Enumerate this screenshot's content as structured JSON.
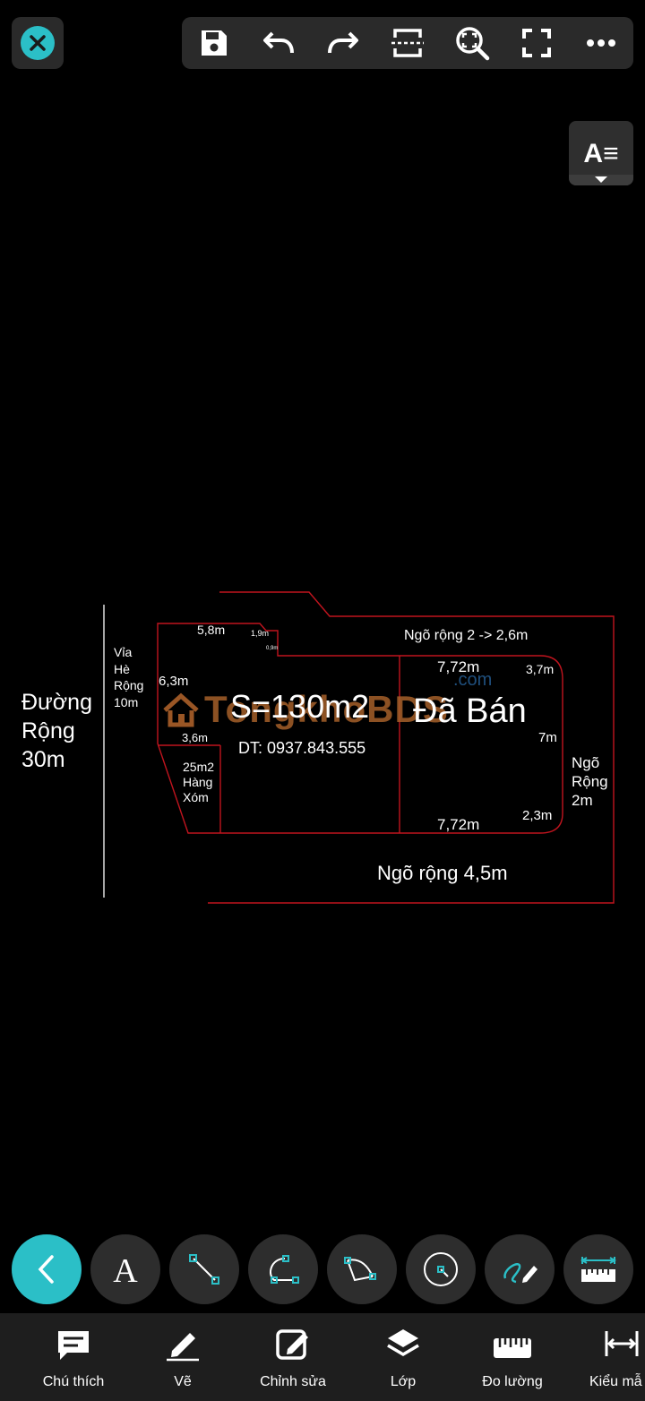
{
  "toolbar": {
    "icons": [
      "close-icon",
      "save-icon",
      "undo-icon",
      "redo-icon",
      "scan-icon",
      "zoom-extents-icon",
      "fullscreen-icon",
      "more-icon"
    ]
  },
  "text_style_button": {
    "label": "A≡"
  },
  "drawing": {
    "road_main": [
      "Đường",
      "Rộng",
      "30m"
    ],
    "sidewalk": [
      "Vỉa",
      "Hè",
      "Rộng",
      "10m"
    ],
    "dim_5_8": "5,8m",
    "dim_1_9": "1,9m",
    "dim_0_9": "0,9m",
    "dim_6_3": "6,3m",
    "dim_3_6": "3,6m",
    "neighbor": [
      "25m2",
      "Hàng",
      "Xóm"
    ],
    "area": "S=130m2",
    "phone": "DT: 0937.843.555",
    "alley_top": "Ngõ rộng 2 -> 2,6m",
    "dim_7_72_top": "7,72m",
    "dim_3_7": "3,7m",
    "sold": "Đã Bán",
    "dim_7m": "7m",
    "dim_7_72_bottom": "7,72m",
    "dim_2_3": "2,3m",
    "alley_right": [
      "Ngõ",
      "Rộng",
      "2m"
    ],
    "alley_bottom": "Ngõ rộng 4,5m",
    "watermark_brand": "TongkhoBDS",
    "watermark_domain": ".com",
    "line_color": "#c0141e"
  },
  "tools": [
    "back-icon",
    "text-icon",
    "line-icon",
    "polyline-icon",
    "arc-icon",
    "circle-icon",
    "freehand-icon",
    "ruler-icon"
  ],
  "bottom_nav": [
    {
      "label": "Chú thích",
      "icon": "comment-icon"
    },
    {
      "label": "Vẽ",
      "icon": "pencil-icon"
    },
    {
      "label": "Chỉnh sửa",
      "icon": "edit-icon"
    },
    {
      "label": "Lớp",
      "icon": "layers-icon"
    },
    {
      "label": "Đo lường",
      "icon": "measure-icon"
    },
    {
      "label": "Kiểu mẫ",
      "icon": "dimension-style-icon"
    }
  ],
  "colors": {
    "accent": "#2bbfc7",
    "background": "#000000",
    "panel": "#2a2a2a"
  }
}
